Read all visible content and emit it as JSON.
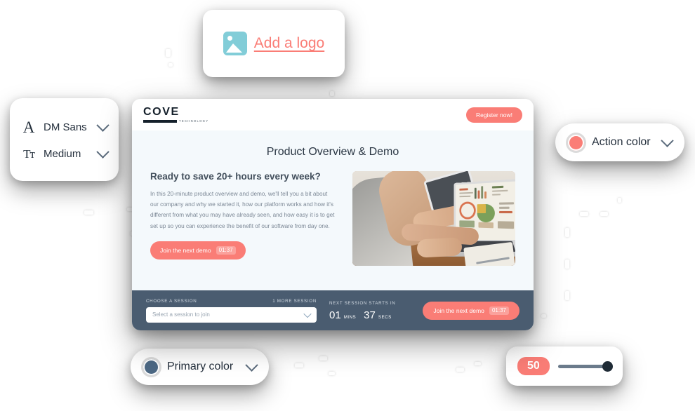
{
  "logo_card": {
    "icon": "image-placeholder-icon",
    "link_label": "Add a logo"
  },
  "font_card": {
    "rows": [
      {
        "glyph": "A",
        "icon_name": "font-family-icon",
        "label": "DM Sans",
        "chevron": "chevron-down-icon"
      },
      {
        "glyph": "Tт",
        "icon_name": "font-weight-icon",
        "label": "Medium",
        "chevron": "chevron-down-icon"
      }
    ]
  },
  "action_color_card": {
    "label": "Action color",
    "swatch_color": "#fa7d76",
    "chevron": "chevron-down-icon"
  },
  "primary_color_card": {
    "label": "Primary color",
    "swatch_color": "#4a6party"
  },
  "primary_color": {
    "label": "Primary color",
    "swatch_color": "#4a6versus"
  },
  "primary_card": {
    "label": "Primary color",
    "swatch_color": "#4c6884",
    "chevron": "chevron-down-icon"
  },
  "slider_card": {
    "value": "50",
    "track_color": "#6b7b8b",
    "thumb_color": "#1f2b36",
    "pill_color": "#fa7d76"
  },
  "browser": {
    "header": {
      "brand_name": "COVE",
      "brand_tagline": "TECHNOLOGY",
      "register_button": "Register now!"
    },
    "page_title": "Product Overview & Demo",
    "hero": {
      "heading": "Ready to save 20+ hours every week?",
      "paragraph": "In this 20-minute product overview and demo, we'll tell you a bit about our company and why we started it, how our platform works and how it's different from what you may have already seen, and how easy it is to get set up so you can experience the benefit of our software from day one.",
      "cta_label": "Join the next demo",
      "cta_timer": "01:37",
      "image_alt": "people-working-on-laptops-with-charts-photo"
    },
    "session_bar": {
      "choose_label": "CHOOSE A SESSION",
      "more_sessions_label": "1 MORE SESSION",
      "select_placeholder": "Select a session to join",
      "countdown_label": "NEXT SESSION STARTS IN",
      "minutes": "01",
      "minutes_unit": "MINS",
      "seconds": "37",
      "seconds_unit": "SECS",
      "cta_label": "Join the next demo",
      "cta_timer": "01:37"
    }
  },
  "theme": {
    "action_color": "#fa7d76",
    "primary_color": "#4c6884",
    "bar_color": "#4a5c70",
    "page_bg": "#f4f9fc"
  }
}
